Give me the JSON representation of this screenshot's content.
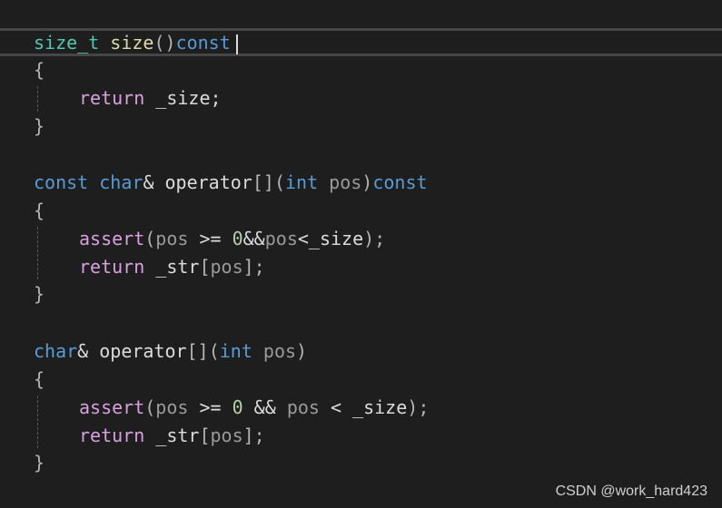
{
  "colors": {
    "background": "#1e1e1e",
    "keyword": "#569cd6",
    "control": "#d8a0df",
    "function": "#dcdcaa",
    "type": "#4ec9b0",
    "parameter": "#9a9a9a",
    "number": "#b5cea8",
    "plain": "#dcdcdc"
  },
  "code": {
    "l1": {
      "type": "size_t",
      "sp1": " ",
      "fn": "size",
      "paren": "()",
      "kw": "const"
    },
    "l2": {
      "brace": "{"
    },
    "l3": {
      "ret": "return",
      "rest": " _size;"
    },
    "l4": {
      "brace": "}"
    },
    "l6": {
      "kw1": "const",
      "sp1": " ",
      "type": "char",
      "amp": "& operator",
      "brk": "[]",
      "lp": "(",
      "kw2": "int",
      "sp2": " ",
      "prm": "pos",
      "rp": ")",
      "kw3": "const"
    },
    "l7": {
      "brace": "{"
    },
    "l8": {
      "fn": "assert",
      "lp": "(",
      "prm1": "pos",
      "op1": " >= ",
      "num": "0",
      "op2": "&&",
      "prm2": "pos",
      "op3": "<",
      "mem": "_size",
      "end": ");"
    },
    "l9": {
      "ret": "return",
      "mem": " _str",
      "lb": "[",
      "prm": "pos",
      "end": "];"
    },
    "l10": {
      "brace": "}"
    },
    "l12": {
      "type": "char",
      "amp": "& operator",
      "brk": "[]",
      "lp": "(",
      "kw": "int",
      "sp": " ",
      "prm": "pos",
      "rp": ")"
    },
    "l13": {
      "brace": "{"
    },
    "l14": {
      "fn": "assert",
      "lp": "(",
      "prm1": "pos",
      "op1": " >= ",
      "num": "0",
      "op2": " && ",
      "prm2": "pos",
      "op3": " < ",
      "mem": "_size",
      "end": ");"
    },
    "l15": {
      "ret": "return",
      "mem": " _str",
      "lb": "[",
      "prm": "pos",
      "end": "];"
    },
    "l16": {
      "brace": "}"
    }
  },
  "watermark": "CSDN @work_hard423"
}
